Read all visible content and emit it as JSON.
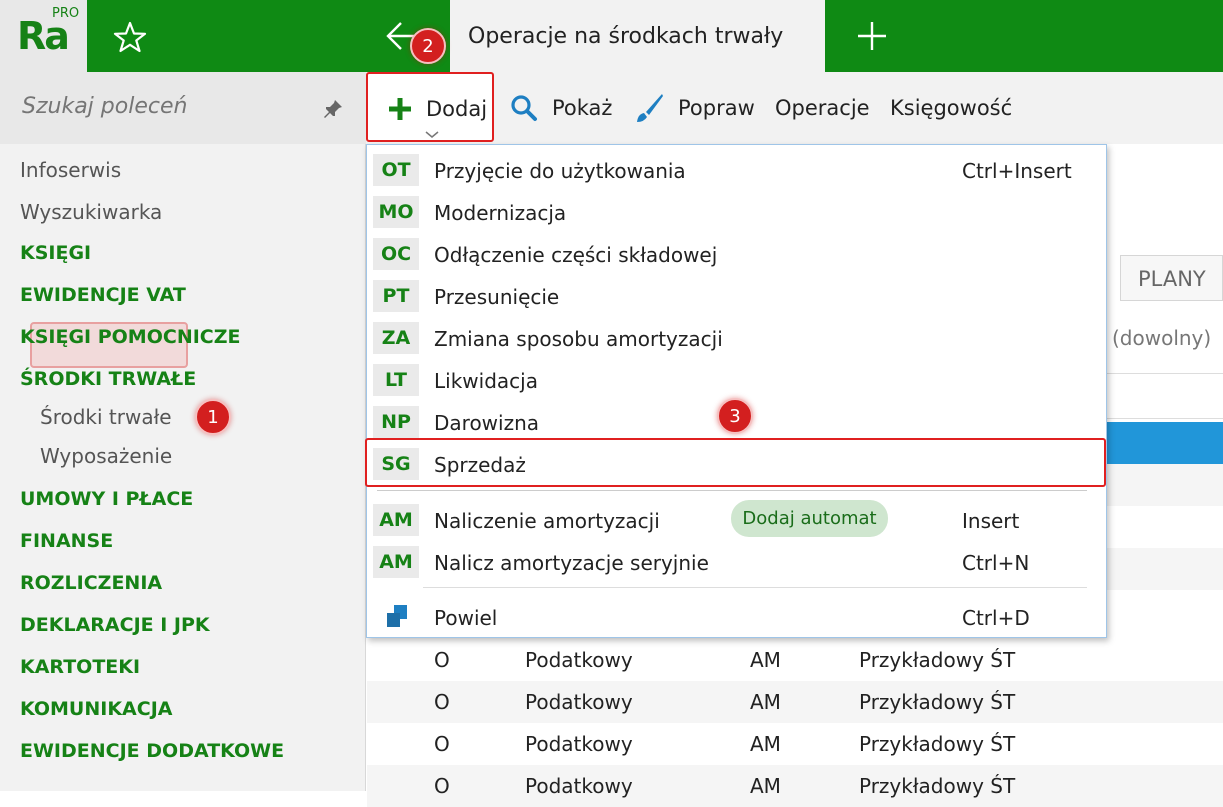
{
  "app": {
    "logo": "Ra",
    "logo_badge": "PRO",
    "tab_title": "Operacje na środkach trwały"
  },
  "sidebar": {
    "search_placeholder": "Szukaj poleceń",
    "items": [
      {
        "label": "Infoserwis",
        "style": "plain"
      },
      {
        "label": "Wyszukiwarka",
        "style": "plain"
      },
      {
        "label": "KSIĘGI",
        "style": "section"
      },
      {
        "label": "EWIDENCJE VAT",
        "style": "section"
      },
      {
        "label": "KSIĘGI POMOCNICZE",
        "style": "section"
      },
      {
        "label": "ŚRODKI TRWAŁE",
        "style": "section"
      },
      {
        "label": "Środki trwałe",
        "style": "sub",
        "selected": true
      },
      {
        "label": "Wyposażenie",
        "style": "sub"
      },
      {
        "label": "UMOWY I PŁACE",
        "style": "section"
      },
      {
        "label": "FINANSE",
        "style": "section"
      },
      {
        "label": "ROZLICZENIA",
        "style": "section"
      },
      {
        "label": "DEKLARACJE I JPK",
        "style": "section"
      },
      {
        "label": "KARTOTEKI",
        "style": "section"
      },
      {
        "label": "KOMUNIKACJA",
        "style": "section"
      },
      {
        "label": "EWIDENCJE DODATKOWE",
        "style": "section"
      }
    ]
  },
  "toolbar": {
    "add": "Dodaj",
    "show": "Pokaż",
    "edit": "Popraw",
    "operations": "Operacje",
    "accounting": "Księgowość"
  },
  "dropdown": {
    "items": [
      {
        "code": "OT",
        "label": "Przyjęcie do użytkowania",
        "shortcut": "Ctrl+Insert"
      },
      {
        "code": "MO",
        "label": "Modernizacja",
        "shortcut": ""
      },
      {
        "code": "OC",
        "label": "Odłączenie części składowej",
        "shortcut": ""
      },
      {
        "code": "PT",
        "label": "Przesunięcie",
        "shortcut": ""
      },
      {
        "code": "ZA",
        "label": "Zmiana sposobu amortyzacji",
        "shortcut": ""
      },
      {
        "code": "LT",
        "label": "Likwidacja",
        "shortcut": ""
      },
      {
        "code": "NP",
        "label": "Darowizna",
        "shortcut": ""
      },
      {
        "code": "SG",
        "label": "Sprzedaż",
        "shortcut": ""
      }
    ],
    "items2": [
      {
        "code": "AM",
        "label": "Naliczenie amortyzacji",
        "shortcut": "Insert"
      },
      {
        "code": "AM",
        "label": "Nalicz amortyzacje seryjnie",
        "shortcut": "Ctrl+N"
      }
    ],
    "auto_badge": "Dodaj automat",
    "duplicate": {
      "label": "Powiel",
      "shortcut": "Ctrl+D"
    }
  },
  "content": {
    "tab_plans": "PLANY",
    "filter_value": "(dowolny)",
    "rows": [
      {
        "c1": "O",
        "c2": "Podatkowy",
        "c3": "AM",
        "c4": "Przykładowy ŚT"
      },
      {
        "c1": "O",
        "c2": "Podatkowy",
        "c3": "AM",
        "c4": "Przykładowy ŚT"
      },
      {
        "c1": "O",
        "c2": "Podatkowy",
        "c3": "AM",
        "c4": "Przykładowy ŚT"
      },
      {
        "c1": "O",
        "c2": "Podatkowy",
        "c3": "AM",
        "c4": "Przykładowy ŚT"
      }
    ]
  },
  "callouts": [
    "1",
    "2",
    "3"
  ],
  "colors": {
    "brand_green": "#0f8a14",
    "accent_red": "#e02020",
    "selection_blue": "#2196d9"
  }
}
